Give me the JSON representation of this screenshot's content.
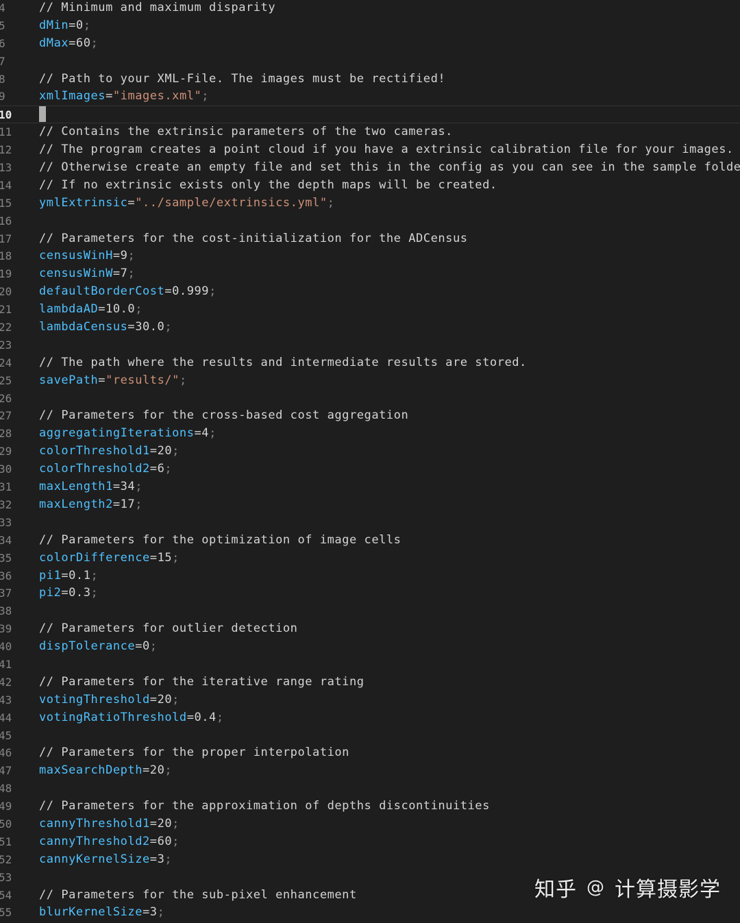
{
  "editor": {
    "cursor_line": "10",
    "lines": [
      {
        "n": "4",
        "tokens": [
          {
            "t": "c",
            "v": "// Minimum and maximum disparity"
          }
        ]
      },
      {
        "n": "5",
        "tokens": [
          {
            "t": "v",
            "v": "dMin"
          },
          {
            "t": "o",
            "v": "=0"
          },
          {
            "t": "s",
            "v": ";"
          }
        ]
      },
      {
        "n": "6",
        "tokens": [
          {
            "t": "v",
            "v": "dMax"
          },
          {
            "t": "o",
            "v": "=60"
          },
          {
            "t": "s",
            "v": ";"
          }
        ]
      },
      {
        "n": "7",
        "tokens": []
      },
      {
        "n": "8",
        "tokens": [
          {
            "t": "c",
            "v": "// Path to your XML-File. The images must be rectified!"
          }
        ]
      },
      {
        "n": "9",
        "tokens": [
          {
            "t": "v",
            "v": "xmlImages"
          },
          {
            "t": "o",
            "v": "="
          },
          {
            "t": "str",
            "v": "\"images.xml\""
          },
          {
            "t": "s",
            "v": ";"
          }
        ]
      },
      {
        "n": "10",
        "tokens": [],
        "active": true
      },
      {
        "n": "11",
        "tokens": [
          {
            "t": "c",
            "v": "// Contains the extrinsic parameters of the two cameras."
          }
        ]
      },
      {
        "n": "12",
        "tokens": [
          {
            "t": "c",
            "v": "// The program creates a point cloud if you have a extrinsic calibration file for your images."
          }
        ]
      },
      {
        "n": "13",
        "tokens": [
          {
            "t": "c",
            "v": "// Otherwise create an empty file and set this in the config as you can see in the sample folder."
          }
        ]
      },
      {
        "n": "14",
        "tokens": [
          {
            "t": "c",
            "v": "// If no extrinsic exists only the depth maps will be created."
          }
        ]
      },
      {
        "n": "15",
        "tokens": [
          {
            "t": "v",
            "v": "ymlExtrinsic"
          },
          {
            "t": "o",
            "v": "="
          },
          {
            "t": "str",
            "v": "\"../sample/extrinsics.yml\""
          },
          {
            "t": "s",
            "v": ";"
          }
        ]
      },
      {
        "n": "16",
        "tokens": []
      },
      {
        "n": "17",
        "tokens": [
          {
            "t": "c",
            "v": "// Parameters for the cost-initialization for the ADCensus"
          }
        ]
      },
      {
        "n": "18",
        "tokens": [
          {
            "t": "v",
            "v": "censusWinH"
          },
          {
            "t": "o",
            "v": "=9"
          },
          {
            "t": "s",
            "v": ";"
          }
        ]
      },
      {
        "n": "19",
        "tokens": [
          {
            "t": "v",
            "v": "censusWinW"
          },
          {
            "t": "o",
            "v": "=7"
          },
          {
            "t": "s",
            "v": ";"
          }
        ]
      },
      {
        "n": "20",
        "tokens": [
          {
            "t": "v",
            "v": "defaultBorderCost"
          },
          {
            "t": "o",
            "v": "=0.999"
          },
          {
            "t": "s",
            "v": ";"
          }
        ]
      },
      {
        "n": "21",
        "tokens": [
          {
            "t": "v",
            "v": "lambdaAD"
          },
          {
            "t": "o",
            "v": "=10.0"
          },
          {
            "t": "s",
            "v": ";"
          }
        ]
      },
      {
        "n": "22",
        "tokens": [
          {
            "t": "v",
            "v": "lambdaCensus"
          },
          {
            "t": "o",
            "v": "=30.0"
          },
          {
            "t": "s",
            "v": ";"
          }
        ]
      },
      {
        "n": "23",
        "tokens": []
      },
      {
        "n": "24",
        "tokens": [
          {
            "t": "c",
            "v": "// The path where the results and intermediate results are stored."
          }
        ]
      },
      {
        "n": "25",
        "tokens": [
          {
            "t": "v",
            "v": "savePath"
          },
          {
            "t": "o",
            "v": "="
          },
          {
            "t": "str",
            "v": "\"results/\""
          },
          {
            "t": "s",
            "v": ";"
          }
        ]
      },
      {
        "n": "26",
        "tokens": []
      },
      {
        "n": "27",
        "tokens": [
          {
            "t": "c",
            "v": "// Parameters for the cross-based cost aggregation"
          }
        ]
      },
      {
        "n": "28",
        "tokens": [
          {
            "t": "v",
            "v": "aggregatingIterations"
          },
          {
            "t": "o",
            "v": "=4"
          },
          {
            "t": "s",
            "v": ";"
          }
        ]
      },
      {
        "n": "29",
        "tokens": [
          {
            "t": "v",
            "v": "colorThreshold1"
          },
          {
            "t": "o",
            "v": "=20"
          },
          {
            "t": "s",
            "v": ";"
          }
        ]
      },
      {
        "n": "30",
        "tokens": [
          {
            "t": "v",
            "v": "colorThreshold2"
          },
          {
            "t": "o",
            "v": "=6"
          },
          {
            "t": "s",
            "v": ";"
          }
        ]
      },
      {
        "n": "31",
        "tokens": [
          {
            "t": "v",
            "v": "maxLength1"
          },
          {
            "t": "o",
            "v": "=34"
          },
          {
            "t": "s",
            "v": ";"
          }
        ]
      },
      {
        "n": "32",
        "tokens": [
          {
            "t": "v",
            "v": "maxLength2"
          },
          {
            "t": "o",
            "v": "=17"
          },
          {
            "t": "s",
            "v": ";"
          }
        ]
      },
      {
        "n": "33",
        "tokens": []
      },
      {
        "n": "34",
        "tokens": [
          {
            "t": "c",
            "v": "// Parameters for the optimization of image cells"
          }
        ]
      },
      {
        "n": "35",
        "tokens": [
          {
            "t": "v",
            "v": "colorDifference"
          },
          {
            "t": "o",
            "v": "=15"
          },
          {
            "t": "s",
            "v": ";"
          }
        ]
      },
      {
        "n": "36",
        "tokens": [
          {
            "t": "v",
            "v": "pi1"
          },
          {
            "t": "o",
            "v": "=0.1"
          },
          {
            "t": "s",
            "v": ";"
          }
        ]
      },
      {
        "n": "37",
        "tokens": [
          {
            "t": "v",
            "v": "pi2"
          },
          {
            "t": "o",
            "v": "=0.3"
          },
          {
            "t": "s",
            "v": ";"
          }
        ]
      },
      {
        "n": "38",
        "tokens": []
      },
      {
        "n": "39",
        "tokens": [
          {
            "t": "c",
            "v": "// Parameters for outlier detection"
          }
        ]
      },
      {
        "n": "40",
        "tokens": [
          {
            "t": "v",
            "v": "dispTolerance"
          },
          {
            "t": "o",
            "v": "=0"
          },
          {
            "t": "s",
            "v": ";"
          }
        ]
      },
      {
        "n": "41",
        "tokens": []
      },
      {
        "n": "42",
        "tokens": [
          {
            "t": "c",
            "v": "// Parameters for the iterative range rating"
          }
        ]
      },
      {
        "n": "43",
        "tokens": [
          {
            "t": "v",
            "v": "votingThreshold"
          },
          {
            "t": "o",
            "v": "=20"
          },
          {
            "t": "s",
            "v": ";"
          }
        ]
      },
      {
        "n": "44",
        "tokens": [
          {
            "t": "v",
            "v": "votingRatioThreshold"
          },
          {
            "t": "o",
            "v": "=0.4"
          },
          {
            "t": "s",
            "v": ";"
          }
        ]
      },
      {
        "n": "45",
        "tokens": []
      },
      {
        "n": "46",
        "tokens": [
          {
            "t": "c",
            "v": "// Parameters for the proper interpolation"
          }
        ]
      },
      {
        "n": "47",
        "tokens": [
          {
            "t": "v",
            "v": "maxSearchDepth"
          },
          {
            "t": "o",
            "v": "=20"
          },
          {
            "t": "s",
            "v": ";"
          }
        ]
      },
      {
        "n": "48",
        "tokens": []
      },
      {
        "n": "49",
        "tokens": [
          {
            "t": "c",
            "v": "// Parameters for the approximation of depths discontinuities"
          }
        ]
      },
      {
        "n": "50",
        "tokens": [
          {
            "t": "v",
            "v": "cannyThreshold1"
          },
          {
            "t": "o",
            "v": "=20"
          },
          {
            "t": "s",
            "v": ";"
          }
        ]
      },
      {
        "n": "51",
        "tokens": [
          {
            "t": "v",
            "v": "cannyThreshold2"
          },
          {
            "t": "o",
            "v": "=60"
          },
          {
            "t": "s",
            "v": ";"
          }
        ]
      },
      {
        "n": "52",
        "tokens": [
          {
            "t": "v",
            "v": "cannyKernelSize"
          },
          {
            "t": "o",
            "v": "=3"
          },
          {
            "t": "s",
            "v": ";"
          }
        ]
      },
      {
        "n": "53",
        "tokens": []
      },
      {
        "n": "54",
        "tokens": [
          {
            "t": "c",
            "v": "// Parameters for the sub-pixel enhancement"
          }
        ]
      },
      {
        "n": "55",
        "tokens": [
          {
            "t": "v",
            "v": "blurKernelSize"
          },
          {
            "t": "o",
            "v": "=3"
          },
          {
            "t": "s",
            "v": ";"
          }
        ]
      }
    ]
  },
  "watermark": {
    "site": "知乎",
    "at": "@",
    "handle": "计算摄影学"
  },
  "theme": {
    "background": "#1e1e1e",
    "comment": "#d4d4d4",
    "variable": "#4fc1ff",
    "string": "#ce9178",
    "line_number": "#858585"
  }
}
